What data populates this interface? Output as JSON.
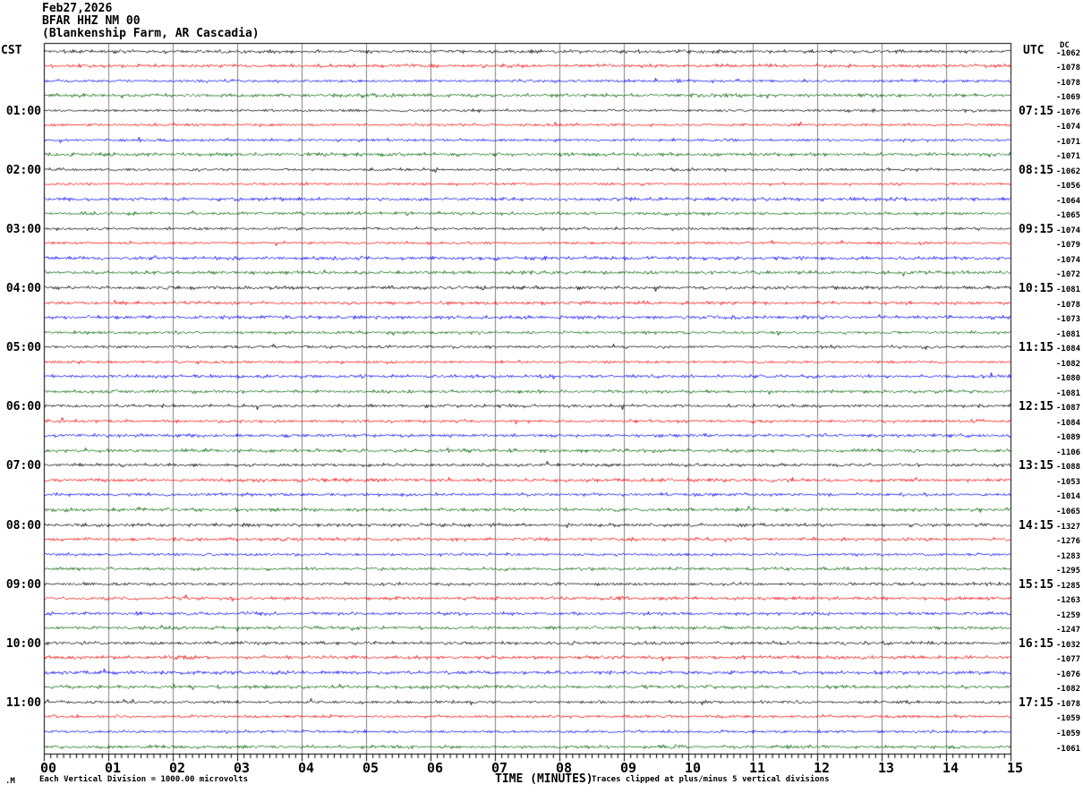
{
  "header": {
    "date": "Feb27,2026",
    "station_line": "BFAR HHZ NM 00",
    "location_line": "(Blankenship Farm, AR Cascadia)"
  },
  "axes": {
    "left_tz": "CST",
    "right_tz": "UTC",
    "dc_header": "DC",
    "x_title": "TIME (MINUTES)",
    "x_tick_labels": [
      "00",
      "01",
      "02",
      "03",
      "04",
      "05",
      "06",
      "07",
      "08",
      "09",
      "10",
      "11",
      "12",
      "13",
      "14",
      "15"
    ]
  },
  "footer": {
    "logo_mark": ".M",
    "scale_note": "Each Vertical Division = 1000.00 microvolts",
    "clip_note": "Traces clipped at plus/minus 5 vertical divisions"
  },
  "chart_data": {
    "type": "line",
    "subtype": "helicorder-seismogram",
    "title": "BFAR HHZ NM 00 (Blankenship Farm, AR Cascadia) Feb27,2026",
    "xlabel": "TIME (MINUTES)",
    "x_range_minutes": [
      0,
      15
    ],
    "major_tick_minutes": 1,
    "minor_tick_minutes": 0.1,
    "minutes_per_row": 15,
    "rows_per_hour": 4,
    "num_rows": 48,
    "grid": "vertical lines at each minute",
    "row_color_cycle": [
      "black",
      "red",
      "blue",
      "green"
    ],
    "colors": {
      "black": "#000000",
      "red": "#ff0000",
      "blue": "#0000ff",
      "green": "#006400",
      "grid": "#808080",
      "border": "#000000"
    },
    "hour_marks": [
      {
        "row": 4,
        "cst": "01:00",
        "utc": "07:15"
      },
      {
        "row": 8,
        "cst": "02:00",
        "utc": "08:15"
      },
      {
        "row": 12,
        "cst": "03:00",
        "utc": "09:15"
      },
      {
        "row": 16,
        "cst": "04:00",
        "utc": "10:15"
      },
      {
        "row": 20,
        "cst": "05:00",
        "utc": "11:15"
      },
      {
        "row": 24,
        "cst": "06:00",
        "utc": "12:15"
      },
      {
        "row": 28,
        "cst": "07:00",
        "utc": "13:15"
      },
      {
        "row": 32,
        "cst": "08:00",
        "utc": "14:15"
      },
      {
        "row": 36,
        "cst": "09:00",
        "utc": "15:15"
      },
      {
        "row": 40,
        "cst": "10:00",
        "utc": "16:15"
      },
      {
        "row": 44,
        "cst": "11:00",
        "utc": "17:15"
      }
    ],
    "dc_offsets_by_row": [
      -1062,
      -1078,
      -1078,
      -1069,
      -1076,
      -1074,
      -1071,
      -1071,
      -1062,
      -1056,
      -1064,
      -1065,
      -1074,
      -1079,
      -1074,
      -1072,
      -1081,
      -1078,
      -1073,
      -1081,
      -1084,
      -1082,
      -1080,
      -1081,
      -1087,
      -1084,
      -1089,
      -1106,
      -1088,
      -1053,
      -1014,
      -1065,
      -1327,
      -1276,
      -1283,
      -1295,
      -1285,
      -1263,
      -1259,
      -1247,
      -1032,
      -1077,
      -1076,
      -1082,
      -1078,
      -1059,
      -1059,
      -1061
    ],
    "trace_character": "continuous low-amplitude background noise, no visible events, clipped at +/-5 divisions"
  }
}
